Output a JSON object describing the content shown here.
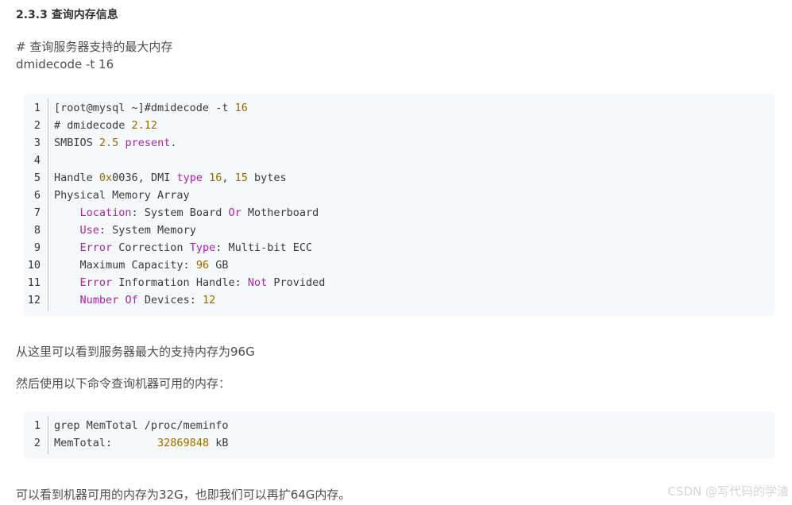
{
  "heading": "2.3.3 查询内存信息",
  "intro_comment": "# 查询服务器支持的最大内存",
  "intro_command": "dmidecode -t 16",
  "code_block_1": {
    "lines": [
      {
        "n": "1",
        "tokens": [
          [
            "plain",
            "[root@mysql ~]#dmidecode -t "
          ],
          [
            "num",
            "16"
          ]
        ]
      },
      {
        "n": "2",
        "tokens": [
          [
            "plain",
            "# dmidecode "
          ],
          [
            "num",
            "2.12"
          ]
        ]
      },
      {
        "n": "3",
        "tokens": [
          [
            "plain",
            "SMBIOS "
          ],
          [
            "num",
            "2.5"
          ],
          [
            "plain",
            " "
          ],
          [
            "kw",
            "present"
          ],
          [
            "plain",
            "."
          ]
        ]
      },
      {
        "n": "4",
        "tokens": []
      },
      {
        "n": "5",
        "tokens": [
          [
            "plain",
            "Handle "
          ],
          [
            "num",
            "0x"
          ],
          [
            "plain",
            "0036, DMI "
          ],
          [
            "kw",
            "type"
          ],
          [
            "plain",
            " "
          ],
          [
            "num",
            "16"
          ],
          [
            "plain",
            ", "
          ],
          [
            "num",
            "15"
          ],
          [
            "plain",
            " bytes"
          ]
        ]
      },
      {
        "n": "6",
        "tokens": [
          [
            "plain",
            "Physical Memory Array"
          ]
        ]
      },
      {
        "n": "7",
        "tokens": [
          [
            "plain",
            "    "
          ],
          [
            "attr",
            "Location"
          ],
          [
            "plain",
            ": System Board "
          ],
          [
            "kw",
            "Or"
          ],
          [
            "plain",
            " Motherboard"
          ]
        ]
      },
      {
        "n": "8",
        "tokens": [
          [
            "plain",
            "    "
          ],
          [
            "attr",
            "Use"
          ],
          [
            "plain",
            ": System Memory"
          ]
        ]
      },
      {
        "n": "9",
        "tokens": [
          [
            "plain",
            "    "
          ],
          [
            "attr",
            "Error"
          ],
          [
            "plain",
            " Correction "
          ],
          [
            "kw",
            "Type"
          ],
          [
            "plain",
            ": Multi-bit ECC"
          ]
        ]
      },
      {
        "n": "10",
        "tokens": [
          [
            "plain",
            "    Maximum Capacity: "
          ],
          [
            "num",
            "96"
          ],
          [
            "plain",
            " GB"
          ]
        ]
      },
      {
        "n": "11",
        "tokens": [
          [
            "plain",
            "    "
          ],
          [
            "attr",
            "Error"
          ],
          [
            "plain",
            " Information Handle: "
          ],
          [
            "kw",
            "Not"
          ],
          [
            "plain",
            " Provided"
          ]
        ]
      },
      {
        "n": "12",
        "tokens": [
          [
            "plain",
            "    "
          ],
          [
            "attr",
            "Number"
          ],
          [
            "plain",
            " "
          ],
          [
            "kw",
            "Of"
          ],
          [
            "plain",
            " Devices: "
          ],
          [
            "num",
            "12"
          ]
        ]
      }
    ]
  },
  "para_1": "从这里可以看到服务器最大的支持内存为96G",
  "para_2": "然后使用以下命令查询机器可用的内存：",
  "code_block_2": {
    "lines": [
      {
        "n": "1",
        "tokens": [
          [
            "plain",
            "grep MemTotal /proc/meminfo"
          ]
        ]
      },
      {
        "n": "2",
        "tokens": [
          [
            "plain",
            "MemTotal:       "
          ],
          [
            "num",
            "32869848"
          ],
          [
            "plain",
            " kB"
          ]
        ]
      }
    ]
  },
  "para_3": "可以看到机器可用的内存为32G，也即我们可以再扩64G内存。",
  "watermark": "CSDN @写代码的学渣",
  "colors": {
    "code_bg": "#f6f8fa",
    "number": "#986801",
    "keyword": "#a626a4",
    "text": "#4d4d4d"
  }
}
